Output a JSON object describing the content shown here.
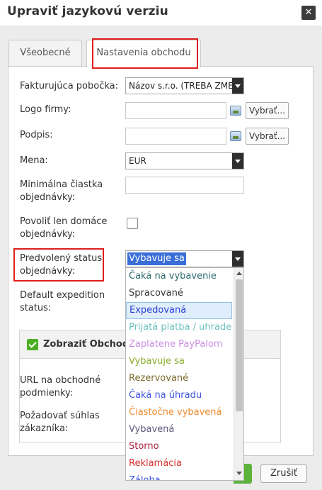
{
  "dialog": {
    "title": "Upraviť jazykovú verziu",
    "close_glyph": "✕"
  },
  "tabs": [
    {
      "label": "Všeobecné",
      "active": false
    },
    {
      "label": "Nastavenia obchodu",
      "active": true
    }
  ],
  "form": {
    "branch_label": "Fakturujúca pobočka:",
    "branch_value": "Názov s.r.o. (TREBA ZMENIŤ)",
    "logo_label": "Logo firmy:",
    "logo_value": "",
    "browse_label": "Vybrať...",
    "signature_label": "Podpis:",
    "signature_value": "",
    "currency_label": "Mena:",
    "currency_value": "EUR",
    "min_amount_label_1": "Minimálna čiastka",
    "min_amount_label_2": "objednávky:",
    "min_amount_value": "",
    "domestic_label_1": "Povoliť len domáce",
    "domestic_label_2": "objednávky:",
    "domestic_checked": false,
    "default_status_label_1": "Predvolený status",
    "default_status_label_2": "objednávky:",
    "default_status_value": "Vybavuje sa",
    "expedition_label_1": "Default expedition",
    "expedition_label_2": "status:"
  },
  "status_options": [
    {
      "label": "Čaká na vybavenie",
      "color": "#2b6a6a"
    },
    {
      "label": "Spracované",
      "color": "#333333"
    },
    {
      "label": "Expedovaná",
      "color": "#2a3fd6",
      "hover": true
    },
    {
      "label": "Prijatá platba / uhradená",
      "color": "#6cc2bf"
    },
    {
      "label": "Zaplatene PayPalom",
      "color": "#c98fe0"
    },
    {
      "label": "Vybavuje sa",
      "color": "#8aab2a"
    },
    {
      "label": "Rezervované",
      "color": "#7d6a2d"
    },
    {
      "label": "Čaká na úhradu",
      "color": "#3d55dc"
    },
    {
      "label": "Čiastočne vybavená",
      "color": "#f08a2c"
    },
    {
      "label": "Vybavená",
      "color": "#5a5a7a"
    },
    {
      "label": "Storno",
      "color": "#a5213d"
    },
    {
      "label": "Reklamácia",
      "color": "#d8302c"
    },
    {
      "label": "Záloha",
      "color": "#3d55dc"
    }
  ],
  "section": {
    "title": "Zobraziť Obchodné podmienky",
    "checked": true,
    "url_label_1": "URL na obchodné",
    "url_label_2": "podmienky:",
    "consent_label_1": "Požadovať súhlas",
    "consent_label_2": "zákazníka:"
  },
  "footer": {
    "cancel_label": "Zrušiť"
  },
  "colors": {
    "highlight": "#e11d1d",
    "selection": "#3a6fd8",
    "confirm_green": "#5cb33b"
  }
}
